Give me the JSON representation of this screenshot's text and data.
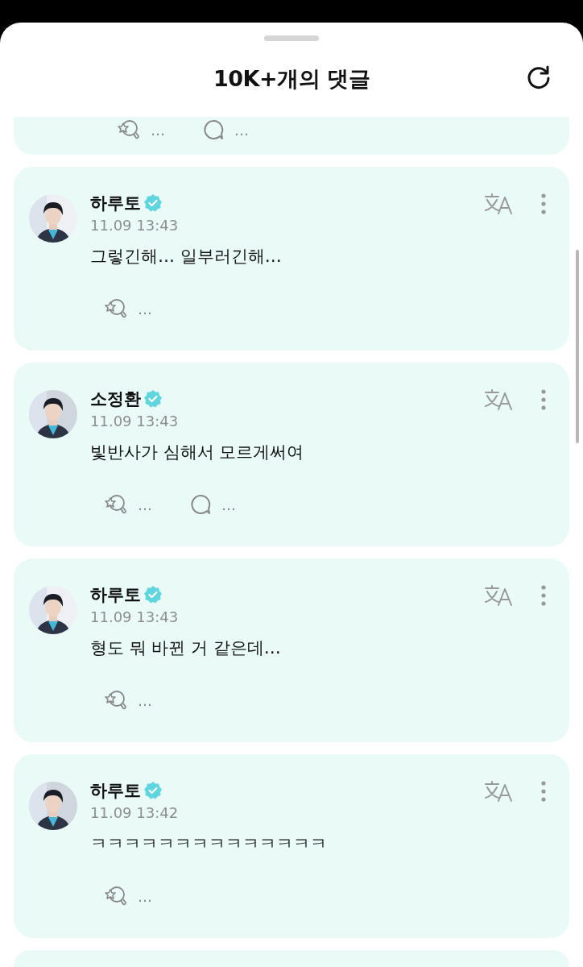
{
  "header": {
    "title": "10K+개의 댓글"
  },
  "top_partial_card": {
    "actions": [
      {
        "kind": "reaction",
        "count": "…"
      },
      {
        "kind": "reply",
        "count": "…"
      }
    ]
  },
  "comments": [
    {
      "name": "하루토",
      "verified": true,
      "date": "11.09 13:43",
      "text": "그렇긴해… 일부러긴해…",
      "actions": [
        {
          "kind": "reaction",
          "count": "…"
        }
      ]
    },
    {
      "name": "소정환",
      "verified": true,
      "date": "11.09 13:43",
      "text": "빛반사가 심해서 모르게써여",
      "actions": [
        {
          "kind": "reaction",
          "count": "…"
        },
        {
          "kind": "reply",
          "count": "…"
        }
      ]
    },
    {
      "name": "하루토",
      "verified": true,
      "date": "11.09 13:43",
      "text": "형도 뭐 바뀐 거 같은데…",
      "actions": [
        {
          "kind": "reaction",
          "count": "…"
        }
      ]
    },
    {
      "name": "하루토",
      "verified": true,
      "date": "11.09 13:42",
      "text": "ㅋㅋㅋㅋㅋㅋㅋㅋㅋㅋㅋㅋㅋㅋ",
      "actions": [
        {
          "kind": "reaction",
          "count": "…"
        }
      ]
    }
  ]
}
